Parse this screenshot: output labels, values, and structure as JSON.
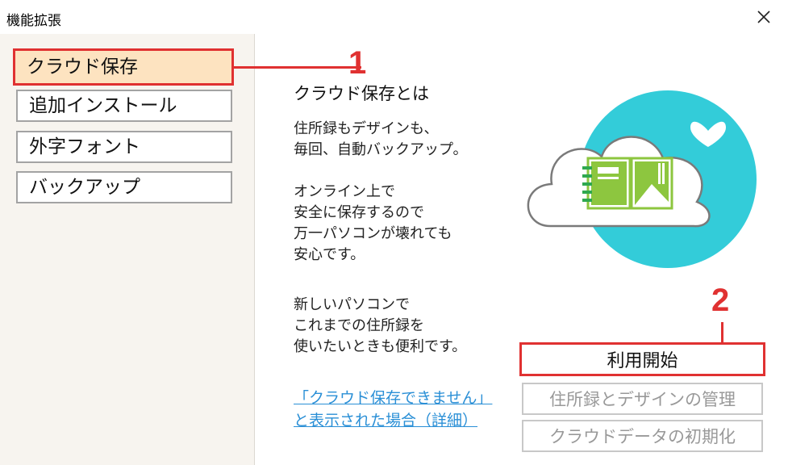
{
  "window": {
    "title": "機能拡張"
  },
  "sidebar": {
    "items": [
      {
        "label": "クラウド保存"
      },
      {
        "label": "追加インストール"
      },
      {
        "label": "外字フォント"
      },
      {
        "label": "バックアップ"
      }
    ]
  },
  "annotations": {
    "one": "1",
    "two": "2"
  },
  "main": {
    "heading": "クラウド保存とは",
    "paragraph1": [
      "住所録もデザインも、",
      "毎回、自動バックアップ。"
    ],
    "paragraph2": [
      "オンライン上で",
      "安全に保存するので",
      "万一パソコンが壊れても",
      "安心です。"
    ],
    "paragraph3": [
      "新しいパソコンで",
      "これまでの住所録を",
      "使いたいときも便利です。"
    ],
    "help_link": [
      "「クラウド保存できません」",
      "と表示された場合（詳細）"
    ]
  },
  "buttons": {
    "start": "利用開始",
    "manage": "住所録とデザインの管理",
    "reset": "クラウドデータの初期化"
  },
  "colors": {
    "accent_red": "#e03131",
    "active_fill": "#fde3c0",
    "cloud_circle": "#33ccd9",
    "book_green": "#8dc63f",
    "link_blue": "#2a8fd6"
  }
}
